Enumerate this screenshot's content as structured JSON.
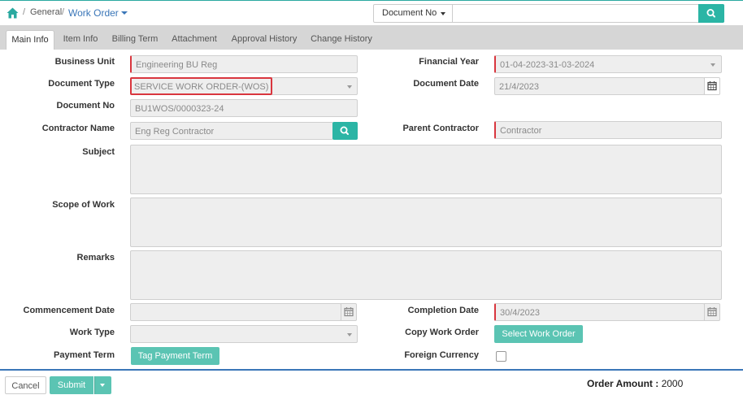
{
  "breadcrumb": {
    "home_icon": "home-icon",
    "separator": "/",
    "general": "General",
    "current": "Work Order"
  },
  "search": {
    "dropdown_label": "Document No",
    "value": "",
    "button_icon": "search-icon"
  },
  "tabs": [
    {
      "label": "Main Info",
      "active": true
    },
    {
      "label": "Item Info",
      "active": false
    },
    {
      "label": "Billing Term",
      "active": false
    },
    {
      "label": "Attachment",
      "active": false
    },
    {
      "label": "Approval History",
      "active": false
    },
    {
      "label": "Change History",
      "active": false
    }
  ],
  "form": {
    "business_unit": {
      "label": "Business Unit",
      "value": "Engineering BU Reg"
    },
    "financial_year": {
      "label": "Financial Year",
      "value": "01-04-2023-31-03-2024"
    },
    "document_type": {
      "label": "Document Type",
      "value": "SERVICE WORK ORDER-(WOS)"
    },
    "document_date": {
      "label": "Document Date",
      "value": "21/4/2023"
    },
    "document_no": {
      "label": "Document No",
      "value": "BU1WOS/0000323-24"
    },
    "contractor_name": {
      "label": "Contractor Name",
      "value": "Eng Reg Contractor"
    },
    "parent_contractor": {
      "label": "Parent Contractor",
      "value": "Contractor"
    },
    "subject": {
      "label": "Subject",
      "value": ""
    },
    "scope_of_work": {
      "label": "Scope of Work",
      "value": ""
    },
    "remarks": {
      "label": "Remarks",
      "value": ""
    },
    "commencement_date": {
      "label": "Commencement Date",
      "value": ""
    },
    "completion_date": {
      "label": "Completion Date",
      "value": "30/4/2023"
    },
    "work_type": {
      "label": "Work Type",
      "value": ""
    },
    "copy_work_order": {
      "label": "Copy Work Order",
      "button": "Select Work Order"
    },
    "payment_term": {
      "label": "Payment Term",
      "button": "Tag Payment Term"
    },
    "foreign_currency": {
      "label": "Foreign Currency",
      "checked": false
    }
  },
  "footer": {
    "cancel": "Cancel",
    "submit": "Submit",
    "order_amount_label": "Order Amount :",
    "order_amount_value": "2000"
  },
  "colors": {
    "accent_teal": "#5bc4b3",
    "link_blue": "#3a76b8",
    "required_red": "#d9363e"
  }
}
